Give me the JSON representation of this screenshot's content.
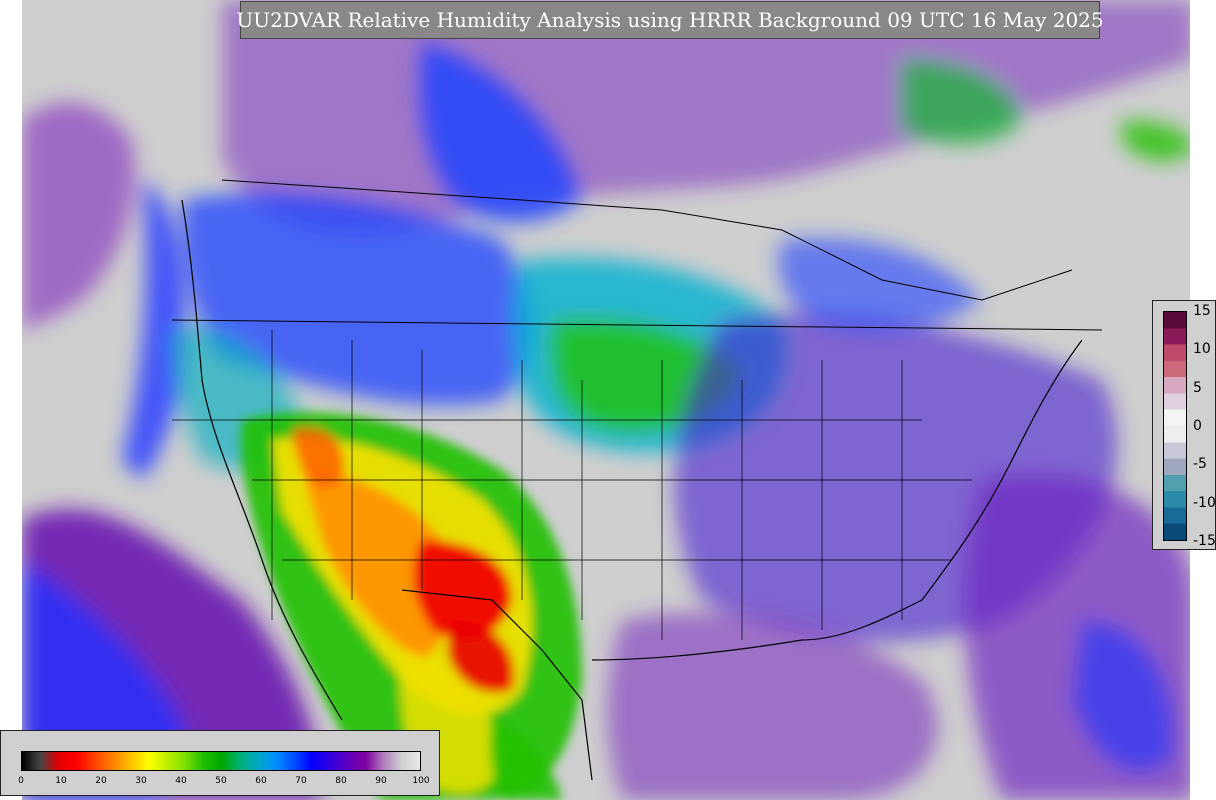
{
  "title": "UU2DVAR Relative Humidity Analysis using HRRR Background 09 UTC 16 May 2025",
  "rh_colorbar": {
    "ticks": [
      "0",
      "10",
      "20",
      "30",
      "40",
      "50",
      "60",
      "70",
      "80",
      "90",
      "100"
    ],
    "colors": [
      "#000000",
      "#444444",
      "#e00000",
      "#ff0000",
      "#ff4000",
      "#ff8000",
      "#ffbf00",
      "#ffff00",
      "#c0f000",
      "#80e000",
      "#20c000",
      "#00a800",
      "#00b070",
      "#00a8c0",
      "#0090ff",
      "#0050ff",
      "#0000ff",
      "#3000e0",
      "#6000c0",
      "#8000a0",
      "#b080c0",
      "#d0d0d0",
      "#e8e8e8"
    ]
  },
  "increment_colorbar": {
    "ticks": [
      "15",
      "10",
      "5",
      "0",
      "-5",
      "-10",
      "-15"
    ],
    "colors": [
      "#5a0a3a",
      "#8a1a5a",
      "#c04a6a",
      "#cc6a7a",
      "#d8a8c0",
      "#e0d0e0",
      "#f4f4f4",
      "#eeeeee",
      "#c8c8d8",
      "#a0a8c0",
      "#50a0b0",
      "#2a8aa8",
      "#1a6a98",
      "#0a4a78"
    ]
  },
  "map_colors": {
    "background": "#cfcfcf",
    "ocean_purple": "#7a20b0",
    "blue": "#1030ff",
    "teal": "#00a0d0",
    "green": "#20c000",
    "yellow": "#f0e000",
    "orange": "#ff9000",
    "red": "#f00000",
    "boundary": "#000000"
  }
}
